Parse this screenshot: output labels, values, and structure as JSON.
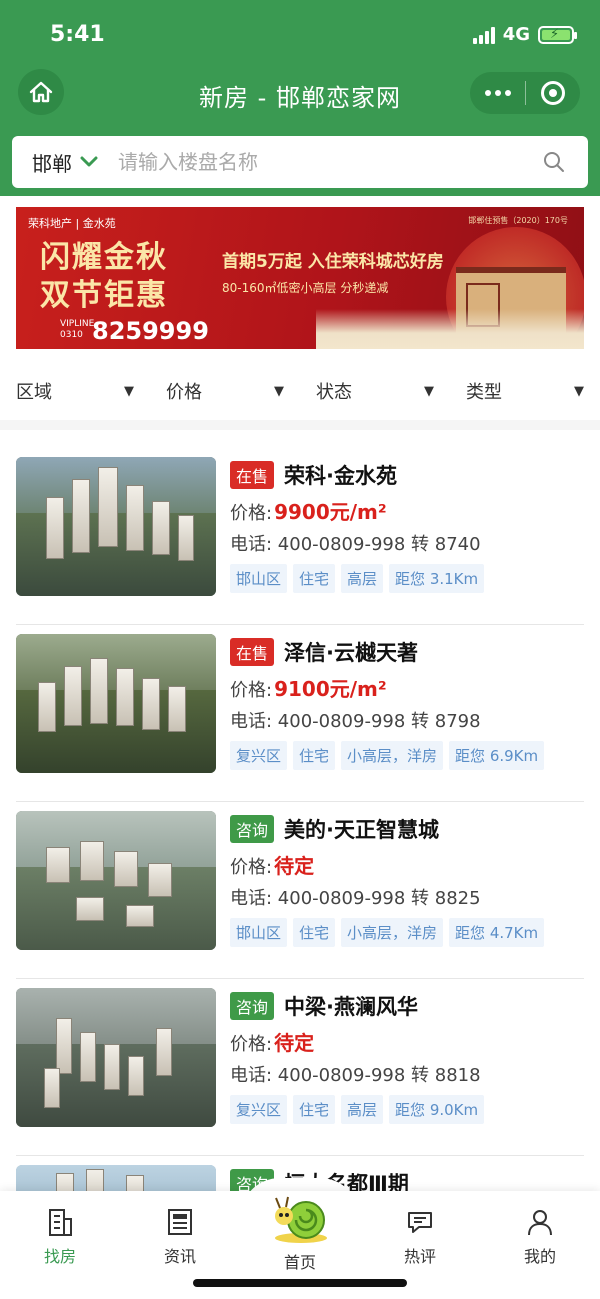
{
  "status": {
    "time": "5:41",
    "network": "4G"
  },
  "header": {
    "title": "新房 - 邯郸恋家网"
  },
  "search": {
    "city": "邯郸",
    "placeholder": "请输入楼盘名称"
  },
  "banner": {
    "brand": "荣科地产 | 金水苑",
    "license": "邯郸住预售（2020）170号",
    "headline_1": "闪耀金秋",
    "headline_2": "双节钜惠",
    "offer": "首期5万起 入住荣科城芯好房",
    "sub": "80-160㎡低密小高层 分秒递减",
    "vip_label_1": "VIPLINE",
    "vip_label_2": "0310",
    "phone": "8259999"
  },
  "filters": [
    {
      "label": "区域"
    },
    {
      "label": "价格"
    },
    {
      "label": "状态"
    },
    {
      "label": "类型"
    }
  ],
  "listings": [
    {
      "status": "在售",
      "status_type": "sale",
      "name": "荣科·金水苑",
      "price_label": "价格:",
      "price": "9900元/m²",
      "phone": "电话: 400-0809-998 转 8740",
      "tags": [
        "邯山区",
        "住宅",
        "高层",
        "距您 3.1Km"
      ]
    },
    {
      "status": "在售",
      "status_type": "sale",
      "name": "泽信·云樾天著",
      "price_label": "价格:",
      "price": "9100元/m²",
      "phone": "电话: 400-0809-998 转 8798",
      "tags": [
        "复兴区",
        "住宅",
        "小高层，洋房",
        "距您 6.9Km"
      ]
    },
    {
      "status": "咨询",
      "status_type": "ask",
      "name": "美的·天正智慧城",
      "price_label": "价格:",
      "price": "待定",
      "phone": "电话: 400-0809-998 转 8825",
      "tags": [
        "邯山区",
        "住宅",
        "小高层，洋房",
        "距您 4.7Km"
      ]
    },
    {
      "status": "咨询",
      "status_type": "ask",
      "name": "中梁·燕澜风华",
      "price_label": "价格:",
      "price": "待定",
      "phone": "电话: 400-0809-998 转 8818",
      "tags": [
        "复兴区",
        "住宅",
        "高层",
        "距您 9.0Km"
      ]
    },
    {
      "status": "咨询",
      "status_type": "ask",
      "name": "恒大名都Ⅲ期"
    }
  ],
  "tabbar": [
    {
      "label": "找房",
      "icon": "building-icon",
      "active": true
    },
    {
      "label": "资讯",
      "icon": "news-icon"
    },
    {
      "label": "首页",
      "icon": "snail-icon"
    },
    {
      "label": "热评",
      "icon": "comment-icon"
    },
    {
      "label": "我的",
      "icon": "user-icon"
    }
  ],
  "colors": {
    "brand_green": "#3a9a52",
    "sale_red": "#d92c26",
    "ask_green": "#3f9a48",
    "price_red": "#d9211c",
    "tag_blue": "#5b8ec7"
  }
}
